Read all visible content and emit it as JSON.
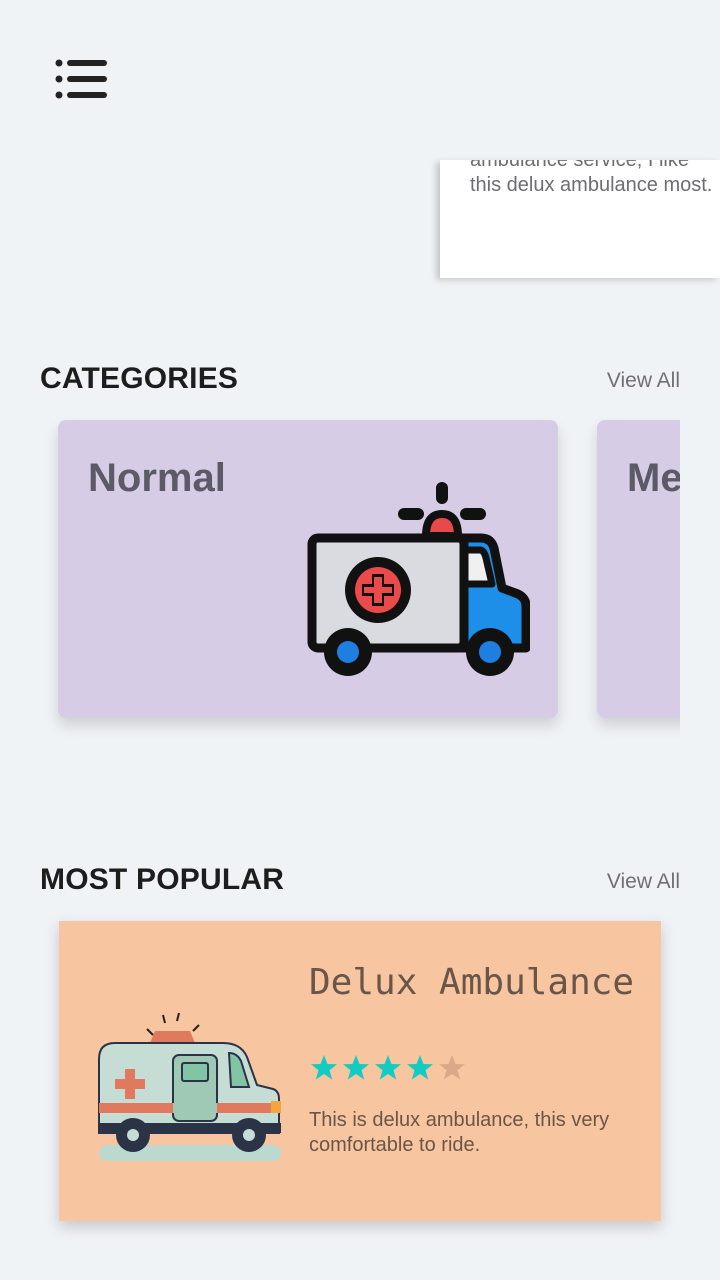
{
  "header": {
    "menu_icon": "menu-list-icon"
  },
  "review": {
    "text": "ambulance service, I like this delux ambulance most."
  },
  "categories": {
    "title": "CATEGORIES",
    "view_all": "View All",
    "items": [
      {
        "name": "Normal",
        "icon": "ambulance-icon"
      },
      {
        "name": "Me",
        "icon": "ambulance-icon"
      }
    ],
    "card_color": "#d6cce6"
  },
  "popular": {
    "title": "MOST POPULAR",
    "view_all": "View All",
    "items": [
      {
        "name": "Delux Ambulance",
        "rating": 4,
        "rating_max": 5,
        "description": "This is delux ambulance, this very comfortable to ride.",
        "card_color": "#f7c59f",
        "star_color": "#12ccc3"
      }
    ]
  }
}
